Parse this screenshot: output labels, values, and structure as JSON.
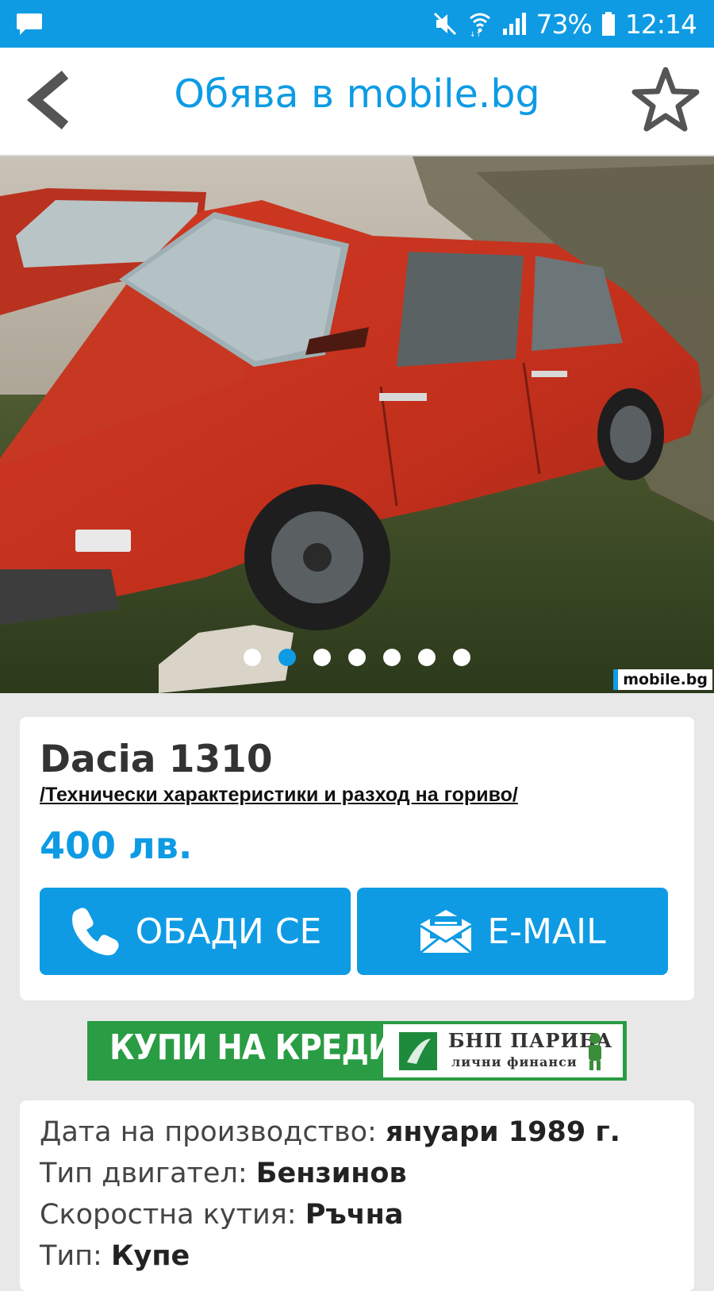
{
  "status_bar": {
    "battery": "73%",
    "time": "12:14"
  },
  "header": {
    "title": "Обява в mobile.bg"
  },
  "gallery": {
    "dot_count": 7,
    "active_index": 1,
    "watermark": "mobile.bg"
  },
  "listing": {
    "name": "Dacia 1310",
    "specs_link": "/Технически характеристики и разход на гориво/",
    "price": "400 лв.",
    "call_label": "ОБАДИ СЕ",
    "email_label": "E-MAIL"
  },
  "banner": {
    "text": "КУПИ НА КРЕДИТ",
    "brand_line1": "БНП ПАРИБА",
    "brand_line2": "лични финанси"
  },
  "details": [
    {
      "label": "Дата на производство:",
      "value": "януари 1989 г."
    },
    {
      "label": "Тип двигател:",
      "value": "Бензинов"
    },
    {
      "label": "Скоростна кутия:",
      "value": "Ръчна"
    },
    {
      "label": "Тип:",
      "value": "Купе"
    }
  ],
  "colors": {
    "accent": "#0e9be4",
    "banner_green": "#2a9c43"
  }
}
